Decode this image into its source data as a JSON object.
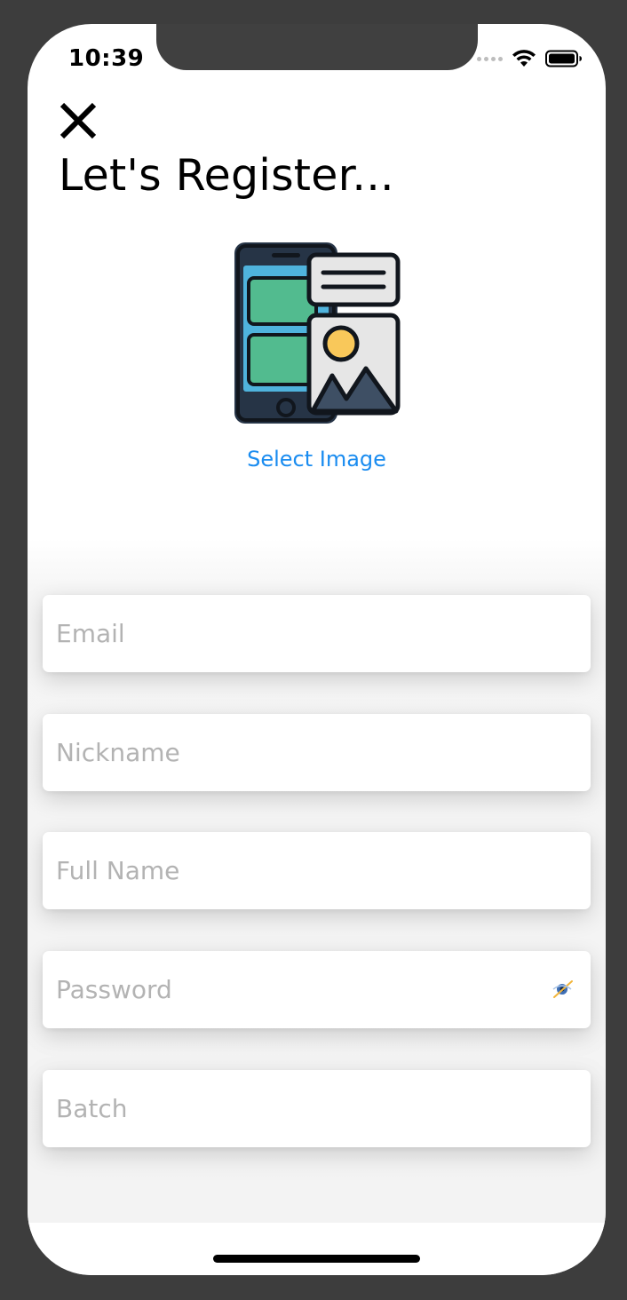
{
  "status_bar": {
    "time": "10:39",
    "icons": [
      "signal-dots-icon",
      "wifi-icon",
      "battery-icon"
    ]
  },
  "header": {
    "close_icon": "close-icon",
    "title": "Let's Register..."
  },
  "avatar_picker": {
    "icon": "phone-image-icon",
    "select_label": "Select Image"
  },
  "form": {
    "email": {
      "placeholder": "Email",
      "value": ""
    },
    "nickname": {
      "placeholder": "Nickname",
      "value": ""
    },
    "full_name": {
      "placeholder": "Full Name",
      "value": ""
    },
    "password": {
      "placeholder": "Password",
      "value": "",
      "toggle_icon": "eye-hidden-icon"
    },
    "batch": {
      "placeholder": "Batch",
      "value": ""
    }
  },
  "colors": {
    "accent": "#1a8cf0",
    "placeholder": "#b3b3b3",
    "background": "#ffffff"
  }
}
